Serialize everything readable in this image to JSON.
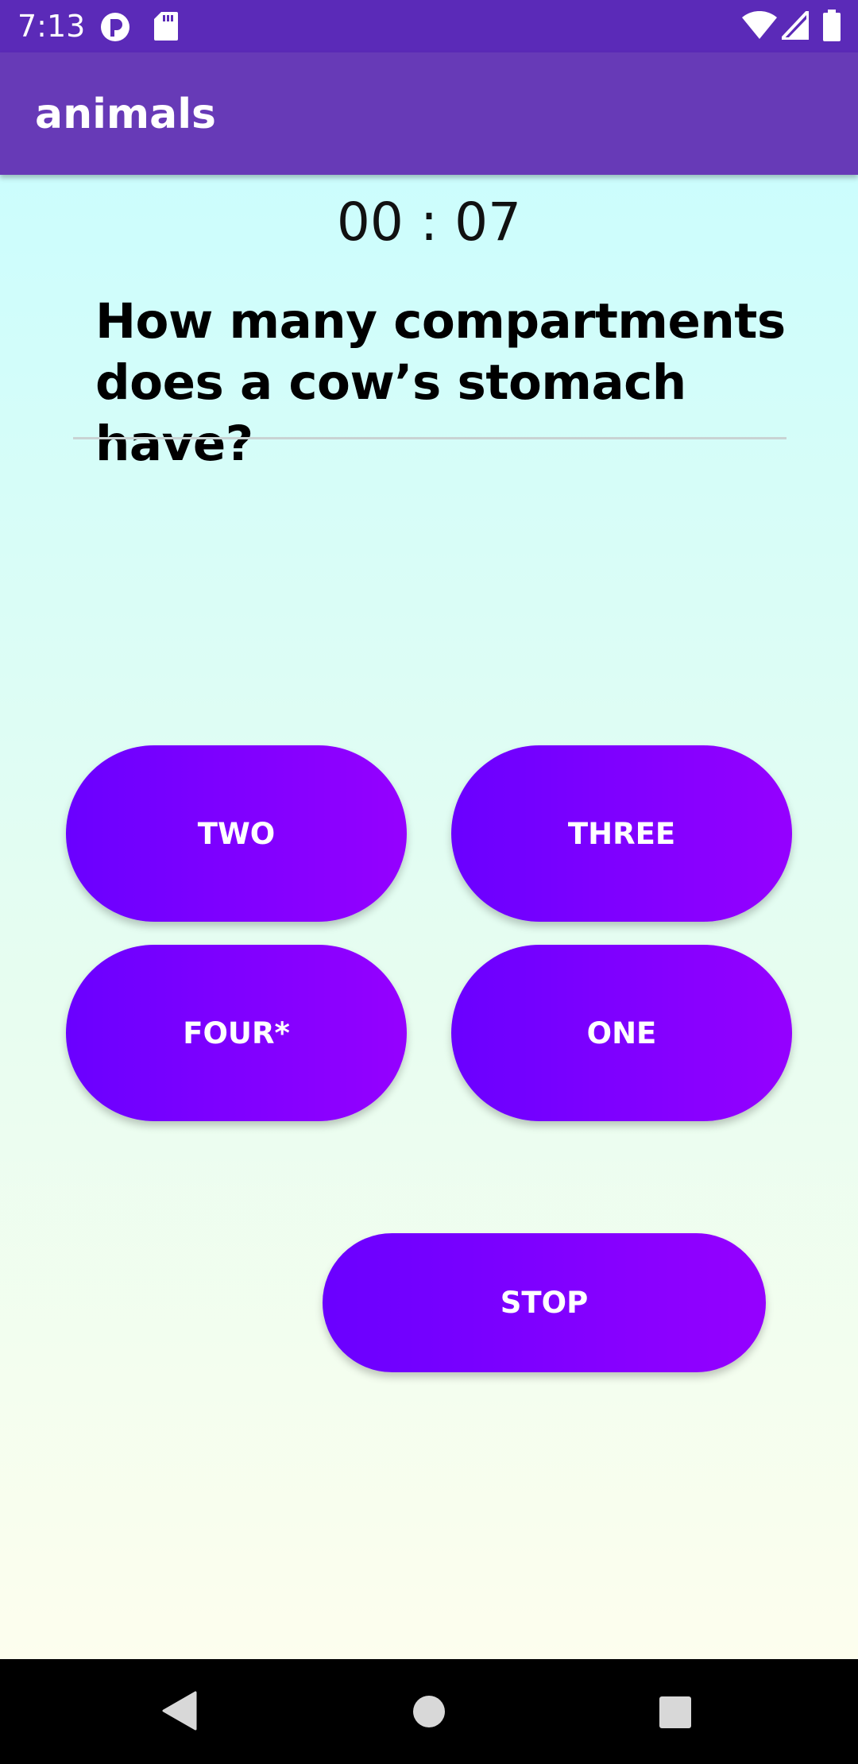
{
  "status_bar": {
    "time": "7:13",
    "icons": [
      "notification-app-icon",
      "sd-card-icon",
      "wifi-icon",
      "cell-signal-icon",
      "battery-icon"
    ]
  },
  "app_bar": {
    "title": "animals"
  },
  "quiz": {
    "timer": "00 : 07",
    "question": "How many compartments does a cow’s stomach have?",
    "answers": [
      "TWO",
      "THREE",
      "FOUR*",
      "ONE"
    ],
    "stop_label": "STOP"
  },
  "nav_bar": {
    "icons": [
      "back-icon",
      "home-icon",
      "recents-icon"
    ]
  },
  "colors": {
    "status_bar": "#5b2ab8",
    "app_bar": "#673ab7",
    "button_gradient_start": "#6a00ff",
    "button_gradient_end": "#9500ff",
    "background_top": "#ccfdfd",
    "background_bottom": "#fdfeee"
  }
}
